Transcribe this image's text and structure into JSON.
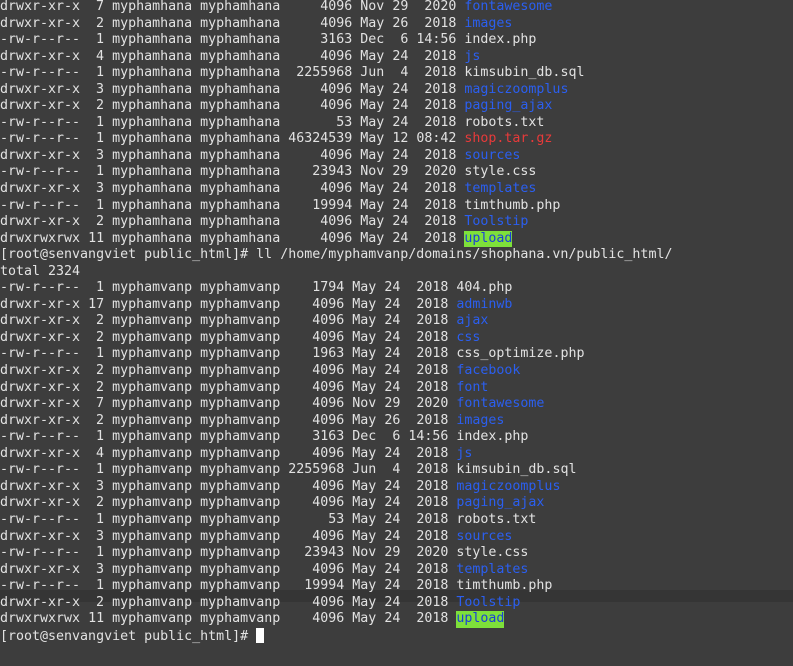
{
  "terminal": {
    "colors": {
      "background": "#3d3d3d",
      "text": "#e2e2e2",
      "directory": "#2b5ff0",
      "archive": "#e83a3a",
      "sticky_bg": "#7ee03a"
    },
    "blocks": [
      {
        "rows": [
          {
            "perm": "drwxr-xr-x",
            "links": "7",
            "user": "myphamhana",
            "group": "myphamhana",
            "size": "4096",
            "month": "Nov",
            "day": "29",
            "time": "2020",
            "name": "fontawesome",
            "kind": "dir"
          },
          {
            "perm": "drwxr-xr-x",
            "links": "2",
            "user": "myphamhana",
            "group": "myphamhana",
            "size": "4096",
            "month": "May",
            "day": "26",
            "time": "2018",
            "name": "images",
            "kind": "dir"
          },
          {
            "perm": "-rw-r--r--",
            "links": "1",
            "user": "myphamhana",
            "group": "myphamhana",
            "size": "3163",
            "month": "Dec",
            "day": "6",
            "time": "14:56",
            "name": "index.php",
            "kind": "file"
          },
          {
            "perm": "drwxr-xr-x",
            "links": "4",
            "user": "myphamhana",
            "group": "myphamhana",
            "size": "4096",
            "month": "May",
            "day": "24",
            "time": "2018",
            "name": "js",
            "kind": "dir"
          },
          {
            "perm": "-rw-r--r--",
            "links": "1",
            "user": "myphamhana",
            "group": "myphamhana",
            "size": "2255968",
            "month": "Jun",
            "day": "4",
            "time": "2018",
            "name": "kimsubin_db.sql",
            "kind": "file"
          },
          {
            "perm": "drwxr-xr-x",
            "links": "3",
            "user": "myphamhana",
            "group": "myphamhana",
            "size": "4096",
            "month": "May",
            "day": "24",
            "time": "2018",
            "name": "magiczoomplus",
            "kind": "dir"
          },
          {
            "perm": "drwxr-xr-x",
            "links": "2",
            "user": "myphamhana",
            "group": "myphamhana",
            "size": "4096",
            "month": "May",
            "day": "24",
            "time": "2018",
            "name": "paging_ajax",
            "kind": "dir"
          },
          {
            "perm": "-rw-r--r--",
            "links": "1",
            "user": "myphamhana",
            "group": "myphamhana",
            "size": "53",
            "month": "May",
            "day": "24",
            "time": "2018",
            "name": "robots.txt",
            "kind": "file"
          },
          {
            "perm": "-rw-r--r--",
            "links": "1",
            "user": "myphamhana",
            "group": "myphamhana",
            "size": "46324539",
            "month": "May",
            "day": "12",
            "time": "08:42",
            "name": "shop.tar.gz",
            "kind": "arch"
          },
          {
            "perm": "drwxr-xr-x",
            "links": "3",
            "user": "myphamhana",
            "group": "myphamhana",
            "size": "4096",
            "month": "May",
            "day": "24",
            "time": "2018",
            "name": "sources",
            "kind": "dir"
          },
          {
            "perm": "-rw-r--r--",
            "links": "1",
            "user": "myphamhana",
            "group": "myphamhana",
            "size": "23943",
            "month": "Nov",
            "day": "29",
            "time": "2020",
            "name": "style.css",
            "kind": "file"
          },
          {
            "perm": "drwxr-xr-x",
            "links": "3",
            "user": "myphamhana",
            "group": "myphamhana",
            "size": "4096",
            "month": "May",
            "day": "24",
            "time": "2018",
            "name": "templates",
            "kind": "dir"
          },
          {
            "perm": "-rw-r--r--",
            "links": "1",
            "user": "myphamhana",
            "group": "myphamhana",
            "size": "19994",
            "month": "May",
            "day": "24",
            "time": "2018",
            "name": "timthumb.php",
            "kind": "file"
          },
          {
            "perm": "drwxr-xr-x",
            "links": "2",
            "user": "myphamhana",
            "group": "myphamhana",
            "size": "4096",
            "month": "May",
            "day": "24",
            "time": "2018",
            "name": "Toolstip",
            "kind": "dir"
          },
          {
            "perm": "drwxrwxrwx",
            "links": "11",
            "user": "myphamhana",
            "group": "myphamhana",
            "size": "4096",
            "month": "May",
            "day": "24",
            "time": "2018",
            "name": "upload",
            "kind": "sticky"
          }
        ]
      },
      {
        "rows": [
          {
            "perm": "-rw-r--r--",
            "links": "1",
            "user": "myphamvanp",
            "group": "myphamvanp",
            "size": "1794",
            "month": "May",
            "day": "24",
            "time": "2018",
            "name": "404.php",
            "kind": "file"
          },
          {
            "perm": "drwxr-xr-x",
            "links": "17",
            "user": "myphamvanp",
            "group": "myphamvanp",
            "size": "4096",
            "month": "May",
            "day": "24",
            "time": "2018",
            "name": "adminwb",
            "kind": "dir"
          },
          {
            "perm": "drwxr-xr-x",
            "links": "2",
            "user": "myphamvanp",
            "group": "myphamvanp",
            "size": "4096",
            "month": "May",
            "day": "24",
            "time": "2018",
            "name": "ajax",
            "kind": "dir"
          },
          {
            "perm": "drwxr-xr-x",
            "links": "2",
            "user": "myphamvanp",
            "group": "myphamvanp",
            "size": "4096",
            "month": "May",
            "day": "24",
            "time": "2018",
            "name": "css",
            "kind": "dir"
          },
          {
            "perm": "-rw-r--r--",
            "links": "1",
            "user": "myphamvanp",
            "group": "myphamvanp",
            "size": "1963",
            "month": "May",
            "day": "24",
            "time": "2018",
            "name": "css_optimize.php",
            "kind": "file"
          },
          {
            "perm": "drwxr-xr-x",
            "links": "2",
            "user": "myphamvanp",
            "group": "myphamvanp",
            "size": "4096",
            "month": "May",
            "day": "24",
            "time": "2018",
            "name": "facebook",
            "kind": "dir"
          },
          {
            "perm": "drwxr-xr-x",
            "links": "2",
            "user": "myphamvanp",
            "group": "myphamvanp",
            "size": "4096",
            "month": "May",
            "day": "24",
            "time": "2018",
            "name": "font",
            "kind": "dir"
          },
          {
            "perm": "drwxr-xr-x",
            "links": "7",
            "user": "myphamvanp",
            "group": "myphamvanp",
            "size": "4096",
            "month": "Nov",
            "day": "29",
            "time": "2020",
            "name": "fontawesome",
            "kind": "dir"
          },
          {
            "perm": "drwxr-xr-x",
            "links": "2",
            "user": "myphamvanp",
            "group": "myphamvanp",
            "size": "4096",
            "month": "May",
            "day": "26",
            "time": "2018",
            "name": "images",
            "kind": "dir"
          },
          {
            "perm": "-rw-r--r--",
            "links": "1",
            "user": "myphamvanp",
            "group": "myphamvanp",
            "size": "3163",
            "month": "Dec",
            "day": "6",
            "time": "14:56",
            "name": "index.php",
            "kind": "file"
          },
          {
            "perm": "drwxr-xr-x",
            "links": "4",
            "user": "myphamvanp",
            "group": "myphamvanp",
            "size": "4096",
            "month": "May",
            "day": "24",
            "time": "2018",
            "name": "js",
            "kind": "dir"
          },
          {
            "perm": "-rw-r--r--",
            "links": "1",
            "user": "myphamvanp",
            "group": "myphamvanp",
            "size": "2255968",
            "month": "Jun",
            "day": "4",
            "time": "2018",
            "name": "kimsubin_db.sql",
            "kind": "file"
          },
          {
            "perm": "drwxr-xr-x",
            "links": "3",
            "user": "myphamvanp",
            "group": "myphamvanp",
            "size": "4096",
            "month": "May",
            "day": "24",
            "time": "2018",
            "name": "magiczoomplus",
            "kind": "dir"
          },
          {
            "perm": "drwxr-xr-x",
            "links": "2",
            "user": "myphamvanp",
            "group": "myphamvanp",
            "size": "4096",
            "month": "May",
            "day": "24",
            "time": "2018",
            "name": "paging_ajax",
            "kind": "dir"
          },
          {
            "perm": "-rw-r--r--",
            "links": "1",
            "user": "myphamvanp",
            "group": "myphamvanp",
            "size": "53",
            "month": "May",
            "day": "24",
            "time": "2018",
            "name": "robots.txt",
            "kind": "file"
          },
          {
            "perm": "drwxr-xr-x",
            "links": "3",
            "user": "myphamvanp",
            "group": "myphamvanp",
            "size": "4096",
            "month": "May",
            "day": "24",
            "time": "2018",
            "name": "sources",
            "kind": "dir"
          },
          {
            "perm": "-rw-r--r--",
            "links": "1",
            "user": "myphamvanp",
            "group": "myphamvanp",
            "size": "23943",
            "month": "Nov",
            "day": "29",
            "time": "2020",
            "name": "style.css",
            "kind": "file"
          },
          {
            "perm": "drwxr-xr-x",
            "links": "3",
            "user": "myphamvanp",
            "group": "myphamvanp",
            "size": "4096",
            "month": "May",
            "day": "24",
            "time": "2018",
            "name": "templates",
            "kind": "dir"
          },
          {
            "perm": "-rw-r--r--",
            "links": "1",
            "user": "myphamvanp",
            "group": "myphamvanp",
            "size": "19994",
            "month": "May",
            "day": "24",
            "time": "2018",
            "name": "timthumb.php",
            "kind": "file"
          },
          {
            "perm": "drwxr-xr-x",
            "links": "2",
            "user": "myphamvanp",
            "group": "myphamvanp",
            "size": "4096",
            "month": "May",
            "day": "24",
            "time": "2018",
            "name": "Toolstip",
            "kind": "dir"
          },
          {
            "perm": "drwxrwxrwx",
            "links": "11",
            "user": "myphamvanp",
            "group": "myphamvanp",
            "size": "4096",
            "month": "May",
            "day": "24",
            "time": "2018",
            "name": "upload",
            "kind": "sticky"
          }
        ]
      }
    ],
    "command_prompt": "[root@senvangviet public_html]# ll /home/myphamvanp/domains/shophana.vn/public_html/",
    "total_line": "total 2324",
    "final_prompt": "[root@senvangviet public_html]# "
  }
}
